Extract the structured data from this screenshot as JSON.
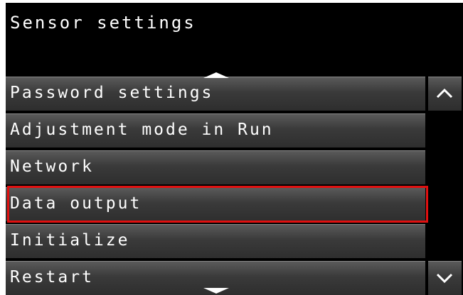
{
  "header": {
    "title": "Sensor settings"
  },
  "menu": {
    "items": [
      {
        "label": "Password settings"
      },
      {
        "label": "Adjustment mode in Run"
      },
      {
        "label": "Network"
      },
      {
        "label": "Data output",
        "highlighted": true
      },
      {
        "label": "Initialize"
      },
      {
        "label": "Restart"
      }
    ],
    "more_above_icon": "triangle-up-icon",
    "more_below_icon": "triangle-down-icon"
  },
  "scrollbar": {
    "up_icon": "chevron-up-icon",
    "down_icon": "chevron-down-icon"
  },
  "colors": {
    "background": "#000000",
    "item_face": "#3a3a3a",
    "text": "#ffffff",
    "highlight": "#e01010"
  }
}
